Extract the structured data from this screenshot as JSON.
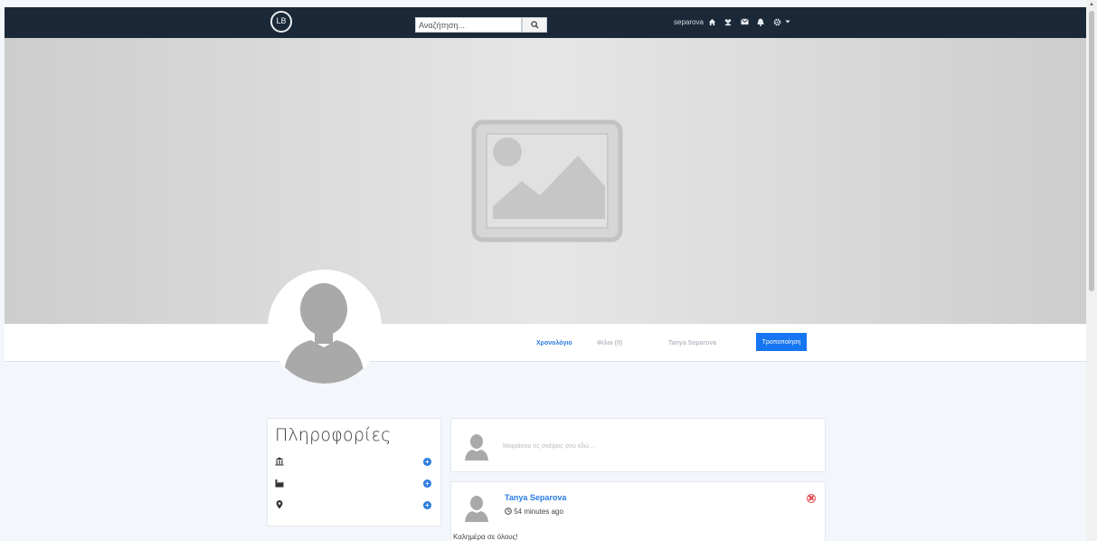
{
  "navbar": {
    "logo_text": "LB",
    "search_placeholder": "Αναζήτηση...",
    "username": "separova",
    "icons": [
      "home-icon",
      "users-icon",
      "envelope-icon",
      "bell-icon",
      "gear-icon",
      "caret-down-icon"
    ]
  },
  "tabs": {
    "timeline": "Χρονολόγιο",
    "friends": "Φίλοι (0)",
    "profile_name": "Tanya Separova",
    "edit": "Τροποποίηση"
  },
  "info": {
    "title": "Πληροφορίες",
    "rows": [
      "institution-icon",
      "industry-icon",
      "map-marker-icon"
    ]
  },
  "composer": {
    "placeholder": "Μοιράσου τις σκέψεις σου εδώ..."
  },
  "post": {
    "author": "Tanya Separova",
    "time": "54 minutes ago",
    "text": "Καλημέρα σε όλους!"
  },
  "colors": {
    "navbar": "#1b2837",
    "accent": "#2a7be0",
    "button": "#1675f0",
    "danger": "#e2474e",
    "background": "#f3f7fc"
  }
}
